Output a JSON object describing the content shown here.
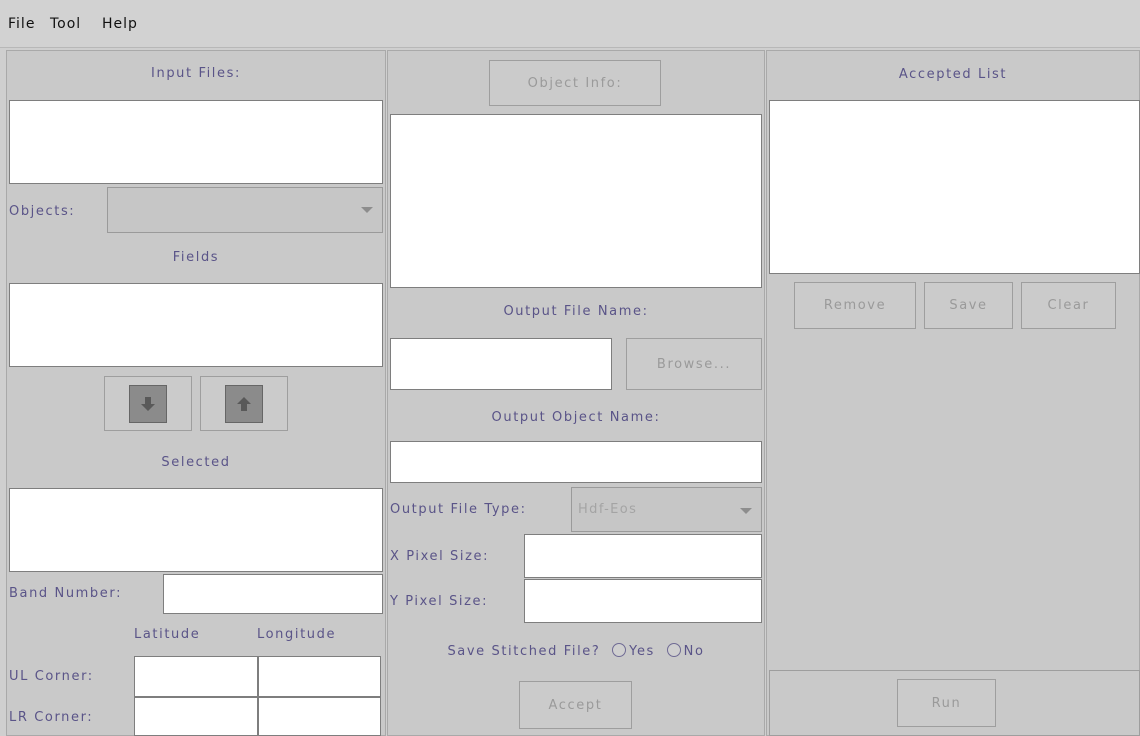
{
  "menu": {
    "file": "File",
    "tool": "Tool",
    "help": "Help"
  },
  "left": {
    "input_files_label": "Input Files:",
    "objects_label": "Objects:",
    "fields_label": "Fields",
    "selected_label": "Selected",
    "band_number_label": "Band Number:",
    "latitude_label": "Latitude",
    "longitude_label": "Longitude",
    "ul_corner_label": "UL Corner:",
    "lr_corner_label": "LR Corner:",
    "move_down_icon": "arrow-down-icon",
    "move_up_icon": "arrow-up-icon"
  },
  "middle": {
    "object_info_button": "Object Info:",
    "output_file_name_label": "Output File Name:",
    "browse_button": "Browse...",
    "output_object_name_label": "Output Object Name:",
    "output_file_type_label": "Output File Type:",
    "output_file_type_value": "Hdf-Eos",
    "x_pixel_size_label": "X Pixel Size:",
    "y_pixel_size_label": "Y Pixel Size:",
    "save_stitched_label": "Save Stitched File?",
    "yes_label": "Yes",
    "no_label": "No",
    "accept_button": "Accept"
  },
  "right": {
    "accepted_list_label": "Accepted List",
    "remove_button": "Remove",
    "save_button": "Save",
    "clear_button": "Clear",
    "run_button": "Run"
  },
  "colors": {
    "label": "#5a5488",
    "panel": "#c9c9c9",
    "disabled_text": "#9a9a9a"
  }
}
